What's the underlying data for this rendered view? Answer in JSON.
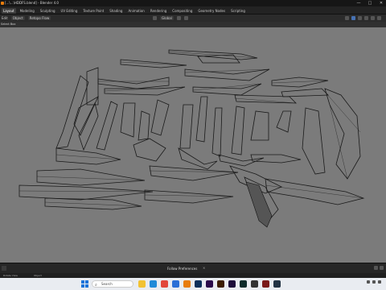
{
  "window": {
    "title": "[...\\...\\HDDFS.blend] - Blender 4.0",
    "controls": [
      "—",
      "□",
      "✕"
    ]
  },
  "menubar": {
    "workspaces": [
      "Layout",
      "Modeling",
      "Sculpting",
      "UV Editing",
      "Texture Paint",
      "Shading",
      "Animation",
      "Rendering",
      "Compositing",
      "Geometry Nodes",
      "Scripting"
    ],
    "active": "Layout",
    "scene": "Scene",
    "view_layer": "ViewLayer"
  },
  "header": {
    "mode": "Edit",
    "object_menu": "Object",
    "viewport_label": "Retopo Flow",
    "transform": "Global",
    "select_box": "Select Box"
  },
  "viewport": {
    "background": "#7b7b7b",
    "wire_color": "#1a1a1a"
  },
  "timeline": {
    "label": "Follow Preferences",
    "close": "×"
  },
  "statusbar": {
    "left": "Rotate View",
    "middle": "Object"
  },
  "taskbar": {
    "search_placeholder": "Search",
    "apps": [
      {
        "name": "folder-icon",
        "color": "#f2c232"
      },
      {
        "name": "edge-icon",
        "color": "#1f8ad8"
      },
      {
        "name": "chrome-icon",
        "color": "#e2473b"
      },
      {
        "name": "store-icon",
        "color": "#2b6fd6"
      },
      {
        "name": "blender-icon",
        "color": "#e87d0d"
      },
      {
        "name": "photoshop-icon",
        "color": "#0a2f5a"
      },
      {
        "name": "premiere-icon",
        "color": "#2a0a4a"
      },
      {
        "name": "illustrator-icon",
        "color": "#3b1d00"
      },
      {
        "name": "aftereffects-icon",
        "color": "#1d0c3a"
      },
      {
        "name": "substance-icon",
        "color": "#0b2a2a"
      },
      {
        "name": "zbrush-icon",
        "color": "#333333"
      },
      {
        "name": "marmoset-icon",
        "color": "#7a1a1a"
      },
      {
        "name": "rizom-icon",
        "color": "#223344"
      }
    ]
  }
}
